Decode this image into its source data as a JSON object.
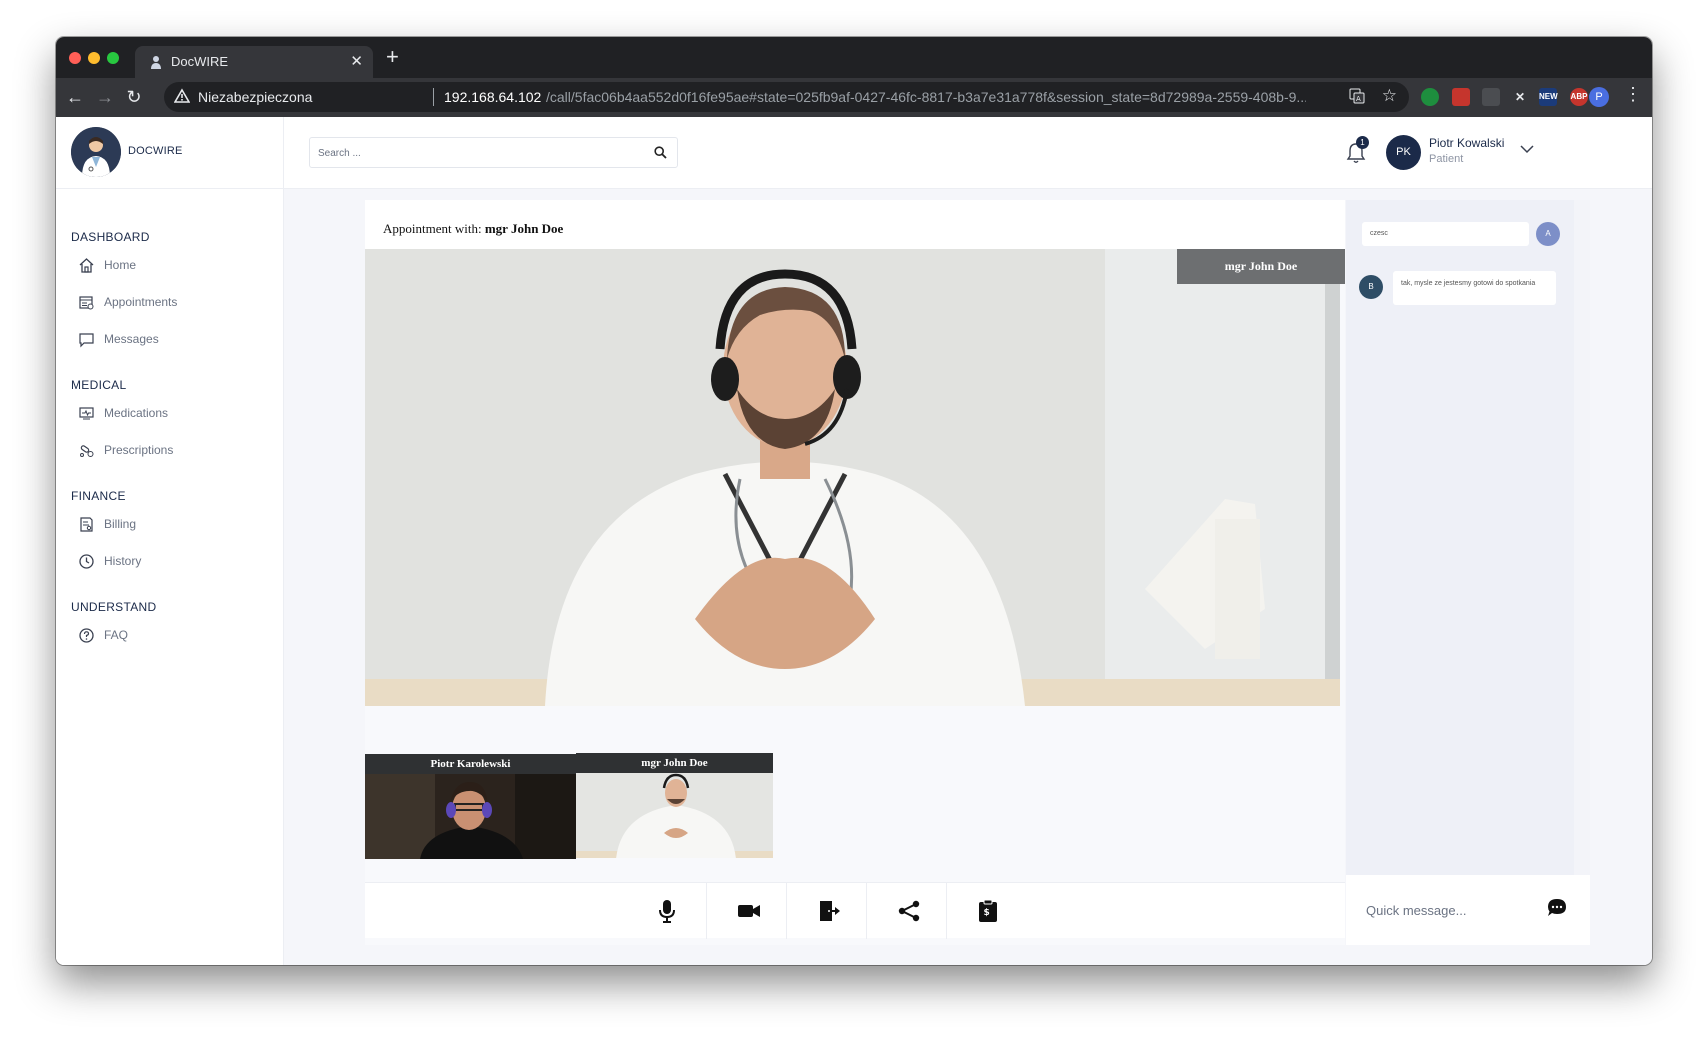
{
  "browser": {
    "tab_title": "DocWIRE",
    "tab_close": "✕",
    "new_tab": "+",
    "security_label": "Niezabezpieczona",
    "url_host": "192.168.64.102",
    "url_path": "/call/5fac06b4aa552d0f16fe95ae#state=025fb9af-0427-46fc-8817-b3a7e31a778f&session_state=8d72989a-2559-408b-9...",
    "extensions": [
      "new-icon",
      "abp-icon"
    ],
    "ext_new_label": "NEW",
    "ext_abp_label": "ABP",
    "profile_initial": "P"
  },
  "sidebar": {
    "logo_text": "DOCWIRE",
    "sections": [
      {
        "title": "DASHBOARD",
        "items": [
          "Home",
          "Appointments",
          "Messages"
        ]
      },
      {
        "title": "MEDICAL",
        "items": [
          "Medications",
          "Prescriptions"
        ]
      },
      {
        "title": "FINANCE",
        "items": [
          "Billing",
          "History"
        ]
      },
      {
        "title": "UNDERSTAND",
        "items": [
          "FAQ"
        ]
      }
    ]
  },
  "header": {
    "search_placeholder": "Search ...",
    "notification_count": "1",
    "user_initials": "PK",
    "user_name": "Piotr Kowalski",
    "user_role": "Patient"
  },
  "call": {
    "appointment_prefix": "Appointment with:",
    "appointment_doctor": "mgr John Doe",
    "main_video_label": "mgr John Doe",
    "thumbnails": [
      "Piotr Karolewski",
      "mgr John Doe"
    ]
  },
  "chat": {
    "messages": [
      {
        "text": "czesc",
        "avatar": "A",
        "side": "right"
      },
      {
        "text": "tak, mysle ze jestesmy gotowi do spotkania",
        "avatar": "B",
        "side": "left"
      }
    ],
    "quick_placeholder": "Quick message..."
  },
  "colors": {
    "accent_navy": "#1b2a49",
    "avatar_a": "#7d8fc8",
    "avatar_b": "#2e4d66"
  }
}
